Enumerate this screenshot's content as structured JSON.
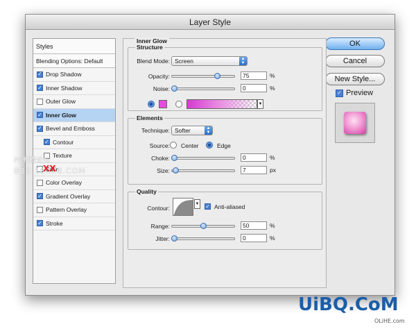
{
  "dialog": {
    "title": "Layer Style"
  },
  "styles_list": {
    "header": "Styles",
    "blending_options": "Blending Options: Default",
    "items": [
      {
        "label": "Drop Shadow",
        "checked": true,
        "selected": false,
        "sub": false
      },
      {
        "label": "Inner Shadow",
        "checked": true,
        "selected": false,
        "sub": false
      },
      {
        "label": "Outer Glow",
        "checked": false,
        "selected": false,
        "sub": false
      },
      {
        "label": "Inner Glow",
        "checked": true,
        "selected": true,
        "sub": false
      },
      {
        "label": "Bevel and Emboss",
        "checked": true,
        "selected": false,
        "sub": false
      },
      {
        "label": "Contour",
        "checked": true,
        "selected": false,
        "sub": true
      },
      {
        "label": "Texture",
        "checked": false,
        "selected": false,
        "sub": true
      },
      {
        "label": "Satin",
        "checked": false,
        "selected": false,
        "sub": false
      },
      {
        "label": "Color Overlay",
        "checked": false,
        "selected": false,
        "sub": false
      },
      {
        "label": "Gradient Overlay",
        "checked": true,
        "selected": false,
        "sub": false
      },
      {
        "label": "Pattern Overlay",
        "checked": false,
        "selected": false,
        "sub": false
      },
      {
        "label": "Stroke",
        "checked": true,
        "selected": false,
        "sub": false
      }
    ]
  },
  "buttons": {
    "ok": "OK",
    "cancel": "Cancel",
    "new_style": "New Style..."
  },
  "preview": {
    "label": "Preview",
    "checked": true
  },
  "inner_glow": {
    "title": "Inner Glow",
    "structure": {
      "title": "Structure",
      "blend_mode_label": "Blend Mode:",
      "blend_mode_value": "Screen",
      "opacity_label": "Opacity:",
      "opacity_value": "75",
      "opacity_level": 0.75,
      "noise_label": "Noise:",
      "noise_value": "0",
      "noise_level": 0,
      "percent": "%",
      "glow_color": "#e64ddc",
      "color_mode": "solid"
    },
    "elements": {
      "title": "Elements",
      "technique_label": "Technique:",
      "technique_value": "Softer",
      "source_label": "Source:",
      "source_center": "Center",
      "source_edge": "Edge",
      "source_selected": "edge",
      "choke_label": "Choke:",
      "choke_value": "0",
      "choke_level": 0,
      "size_label": "Size:",
      "size_value": "7",
      "size_level": 0.028,
      "percent": "%",
      "px": "px"
    },
    "quality": {
      "title": "Quality",
      "contour_label": "Contour:",
      "anti_aliased_label": "Anti-aliased",
      "anti_aliased": true,
      "range_label": "Range:",
      "range_value": "50",
      "range_level": 0.5,
      "jitter_label": "Jitter:",
      "jitter_value": "0",
      "jitter_level": 0,
      "percent": "%"
    }
  },
  "watermarks": {
    "ps_forum": "PS教程论坛",
    "bbs_url": "BBS.16XX8.COM",
    "uibq": "UiBQ.CoM",
    "olihe": "OLiHE.com",
    "xx": "XX"
  },
  "colors": {
    "accent_blue": "#4a7fd0",
    "selected_row": "#b5d3f3",
    "glow_pink": "#e64ddc"
  }
}
